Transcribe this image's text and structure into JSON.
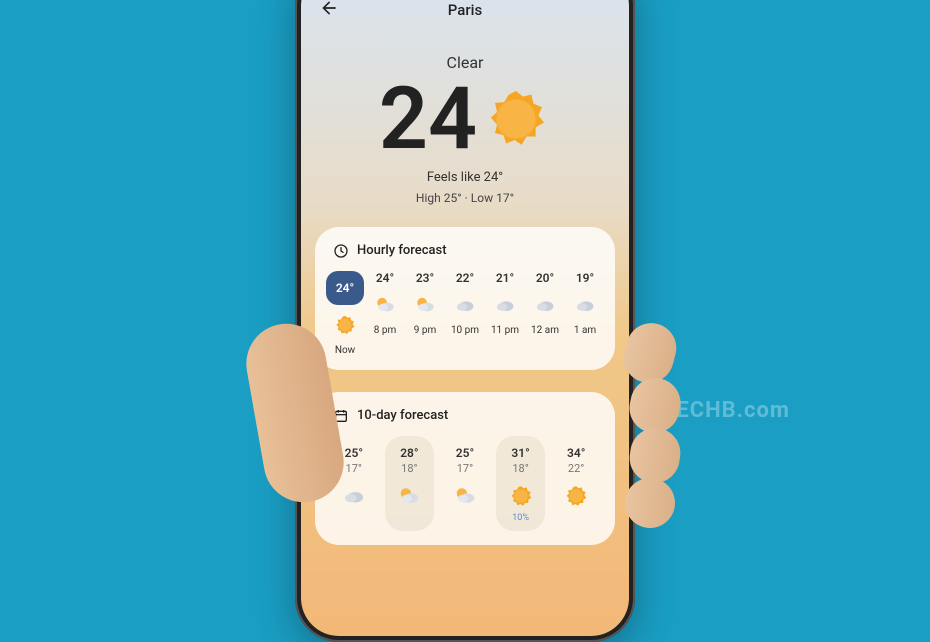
{
  "location": "Paris",
  "condition": "Clear",
  "temperature": "24",
  "feels_like": "Feels like 24°",
  "high_low": "High 25° · Low 17°",
  "hourly": {
    "title": "Hourly forecast",
    "items": [
      {
        "temp": "24°",
        "time": "Now",
        "icon": "sun",
        "highlight": true
      },
      {
        "temp": "24°",
        "time": "8 pm",
        "icon": "partly"
      },
      {
        "temp": "23°",
        "time": "9 pm",
        "icon": "partly"
      },
      {
        "temp": "22°",
        "time": "10 pm",
        "icon": "cloud"
      },
      {
        "temp": "21°",
        "time": "11 pm",
        "icon": "cloud"
      },
      {
        "temp": "20°",
        "time": "12 am",
        "icon": "cloud"
      },
      {
        "temp": "19°",
        "time": "1 am",
        "icon": "cloud"
      }
    ]
  },
  "daily": {
    "title": "10-day forecast",
    "items": [
      {
        "high": "25°",
        "low": "17°",
        "icon": "cloud",
        "precip": ""
      },
      {
        "high": "28°",
        "low": "18°",
        "icon": "partly",
        "precip": ""
      },
      {
        "high": "25°",
        "low": "17°",
        "icon": "partly",
        "precip": ""
      },
      {
        "high": "31°",
        "low": "18°",
        "icon": "sun",
        "precip": "10%"
      },
      {
        "high": "34°",
        "low": "22°",
        "icon": "sun",
        "precip": ""
      }
    ]
  },
  "watermark": "YTECHB.com"
}
